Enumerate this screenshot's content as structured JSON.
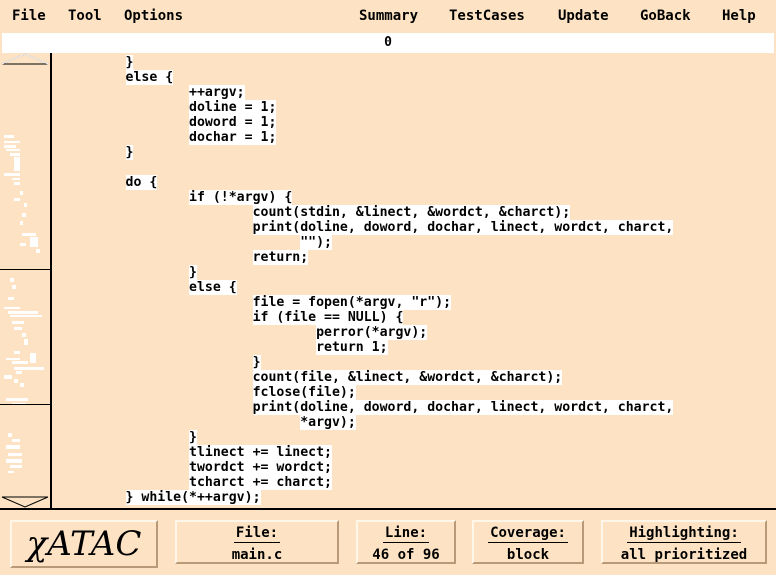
{
  "menu": {
    "file": "File",
    "tool": "Tool",
    "options": "Options",
    "summary": "Summary",
    "testcases": "TestCases",
    "update": "Update",
    "goback": "GoBack",
    "help": "Help"
  },
  "counter": "0",
  "code_lines": [
    {
      "indent": "        ",
      "text": "}"
    },
    {
      "indent": "        ",
      "text": "else {"
    },
    {
      "indent": "                ",
      "text": "++argv;"
    },
    {
      "indent": "                ",
      "text": "doline = 1;"
    },
    {
      "indent": "                ",
      "text": "doword = 1;"
    },
    {
      "indent": "                ",
      "text": "dochar = 1;"
    },
    {
      "indent": "        ",
      "text": "}"
    },
    {
      "indent": "",
      "text": ""
    },
    {
      "indent": "        ",
      "text": "do {"
    },
    {
      "indent": "                ",
      "text": "if (!*argv) {"
    },
    {
      "indent": "                        ",
      "text": "count(stdin, &linect, &wordct, &charct);"
    },
    {
      "indent": "                        ",
      "text": "print(doline, doword, dochar, linect, wordct, charct,"
    },
    {
      "indent": "                              ",
      "text": "\"\");"
    },
    {
      "indent": "                        ",
      "text": "return;"
    },
    {
      "indent": "                ",
      "text": "}"
    },
    {
      "indent": "                ",
      "text": "else {"
    },
    {
      "indent": "                        ",
      "text": "file = fopen(*argv, \"r\");"
    },
    {
      "indent": "                        ",
      "text": "if (file == NULL) {"
    },
    {
      "indent": "                                ",
      "text": "perror(*argv);"
    },
    {
      "indent": "                                ",
      "text": "return 1;"
    },
    {
      "indent": "                        ",
      "text": "}"
    },
    {
      "indent": "                        ",
      "text": "count(file, &linect, &wordct, &charct);"
    },
    {
      "indent": "                        ",
      "text": "fclose(file);"
    },
    {
      "indent": "                        ",
      "text": "print(doline, doword, dochar, linect, wordct, charct,"
    },
    {
      "indent": "                              ",
      "text": "*argv);"
    },
    {
      "indent": "                ",
      "text": "}"
    },
    {
      "indent": "                ",
      "text": "tlinect += linect;"
    },
    {
      "indent": "                ",
      "text": "twordct += wordct;"
    },
    {
      "indent": "                ",
      "text": "tcharct += charct;"
    },
    {
      "indent": "        ",
      "text": "} while(*++argv);"
    }
  ],
  "status": {
    "logo": "χATAC",
    "file_label": "File:",
    "file_value": "main.c",
    "line_label": "Line:",
    "line_value": "46 of 96",
    "coverage_label": "Coverage:",
    "coverage_value": "block",
    "highlighting_label": "Highlighting:",
    "highlighting_value": "all prioritized"
  },
  "colors": {
    "background": "#fde3c4",
    "highlight": "#ffffff"
  }
}
